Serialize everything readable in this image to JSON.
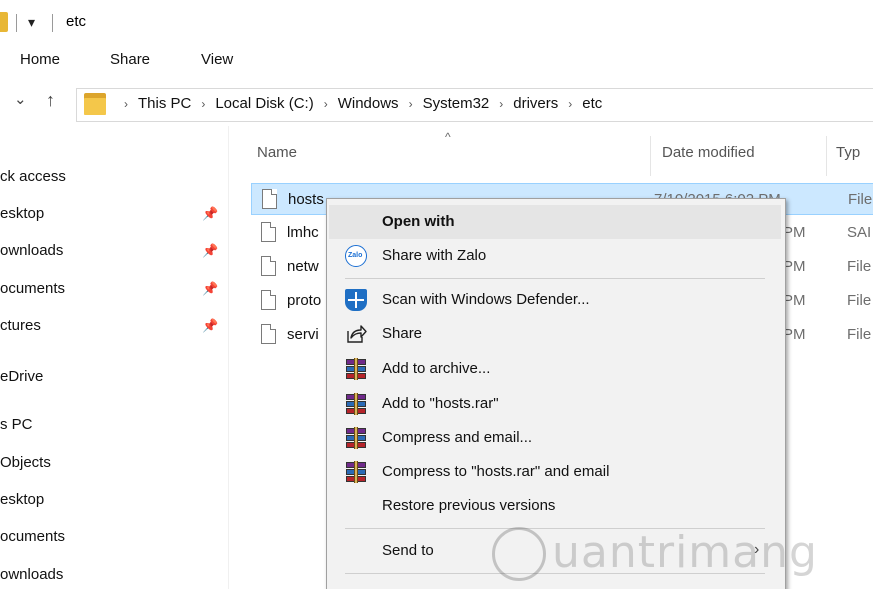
{
  "window": {
    "title": "etc",
    "quick_access_glyph": "▾"
  },
  "ribbon": {
    "tabs": [
      "Home",
      "Share",
      "View"
    ]
  },
  "address": {
    "back_glyph": "⌄",
    "up_glyph": "↑",
    "crumbs": [
      "This PC",
      "Local Disk (C:)",
      "Windows",
      "System32",
      "drivers",
      "etc"
    ],
    "separator": "›"
  },
  "navpane": {
    "items": [
      {
        "label": "ck access",
        "pinned": false
      },
      {
        "label": "esktop",
        "pinned": true
      },
      {
        "label": "ownloads",
        "pinned": true
      },
      {
        "label": "ocuments",
        "pinned": true
      },
      {
        "label": "ctures",
        "pinned": true
      },
      {
        "label": "eDrive",
        "pinned": false
      },
      {
        "label": "s PC",
        "pinned": false
      },
      {
        "label": "Objects",
        "pinned": false
      },
      {
        "label": "esktop",
        "pinned": false
      },
      {
        "label": "ocuments",
        "pinned": false
      },
      {
        "label": "ownloads",
        "pinned": false
      }
    ],
    "pin_glyph": "📌"
  },
  "filelist": {
    "sort_glyph": "^",
    "columns": {
      "name": "Name",
      "date": "Date modified",
      "type": "Typ"
    },
    "rows": [
      {
        "name": "hosts",
        "date": "7/10/2015 6:02 PM",
        "type": "File",
        "selected": true
      },
      {
        "name": "lmhc",
        "date": "PM",
        "type": "SAI",
        "selected": false
      },
      {
        "name": "netw",
        "date": "PM",
        "type": "File",
        "selected": false
      },
      {
        "name": "proto",
        "date": "PM",
        "type": "File",
        "selected": false
      },
      {
        "name": "servi",
        "date": "PM",
        "type": "File",
        "selected": false
      }
    ]
  },
  "context_menu": {
    "items": [
      {
        "label": "Open with",
        "bold": true,
        "icon": "",
        "hover": true
      },
      {
        "label": "Share with Zalo",
        "bold": false,
        "icon": "zalo-icon"
      },
      {
        "label": "Scan with Windows Defender...",
        "bold": false,
        "icon": "windows-defender-icon"
      },
      {
        "label": "Share",
        "bold": false,
        "icon": "share-icon"
      },
      {
        "label": "Add to archive...",
        "bold": false,
        "icon": "winrar-icon"
      },
      {
        "label": "Add to \"hosts.rar\"",
        "bold": false,
        "icon": "winrar-icon"
      },
      {
        "label": "Compress and email...",
        "bold": false,
        "icon": "winrar-icon"
      },
      {
        "label": "Compress to \"hosts.rar\" and email",
        "bold": false,
        "icon": "winrar-icon"
      },
      {
        "label": "Restore previous versions",
        "bold": false,
        "icon": ""
      },
      {
        "label": "Send to",
        "bold": false,
        "icon": "",
        "submenu": true
      }
    ],
    "zalo_icon_text": "Zalo",
    "submenu_glyph": "›"
  },
  "watermark": {
    "text": "uantrimang"
  },
  "colors": {
    "selection_bg": "#cce8ff",
    "selection_border": "#99d1ff",
    "folder": "#f4c74a",
    "menu_bg": "#f2f2f2"
  }
}
